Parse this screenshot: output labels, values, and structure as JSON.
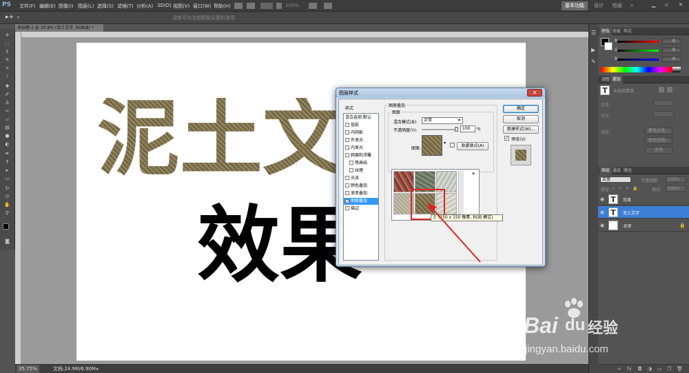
{
  "app": {
    "logo": "PS"
  },
  "menu": [
    "文件(F)",
    "编辑(E)",
    "图像(I)",
    "图层(L)",
    "选择(S)",
    "滤镜(T)",
    "分析(A)",
    "3D(D)",
    "视图(V)",
    "窗口(W)",
    "帮助(H)"
  ],
  "menu_extras": {
    "zoom": "100%"
  },
  "workspace": {
    "essentials": "基本功能",
    "design": "设计",
    "painting": "绘画",
    "more": "»"
  },
  "options_hint": "没有可为当前图层设置的选项",
  "document": {
    "tab_title": "未标题-1 @ 35.8% (泥土文字, RGB/8) *",
    "line1": "泥土文",
    "line2": "效果"
  },
  "statusbar": {
    "zoom": "35.75%",
    "doc_info": "文档:24.9M/6.90M"
  },
  "colors": {
    "accent": "#3d7fd6",
    "texture": "#8a7d57",
    "dialog_bg": "#f0f0f0",
    "arrow": "#e0231f",
    "highlight_box": "#e0231f"
  },
  "panels": {
    "color_tabs": [
      "颜色",
      "色板",
      "样式"
    ],
    "channels": [
      {
        "label": "R",
        "value": "0"
      },
      {
        "label": "G",
        "value": "0"
      },
      {
        "label": "B",
        "value": "0"
      }
    ],
    "char_tabs": [
      "调整",
      "蒙版"
    ],
    "char_hint": "未选择蒙版",
    "char_labels": {
      "density": "浓度:",
      "feather": "羽化:",
      "refine": "调整:"
    },
    "char_buttons": [
      "蒙版边缘...",
      "颜色范围...",
      "反相"
    ],
    "layer_tabs": [
      "图层",
      "通道",
      "路径"
    ],
    "blend_mode": "正常",
    "opacity_label": "不透明度:",
    "opacity_value": "100%",
    "lock_label": "锁定:",
    "fill_label": "填充:",
    "fill_value": "100%",
    "layers": [
      {
        "name": "效果",
        "thumb": "T"
      },
      {
        "name": "泥土文字",
        "thumb": "T"
      },
      {
        "name": "背景",
        "thumb": ""
      }
    ]
  },
  "dialog": {
    "title": "图层样式",
    "styles_header": "样式",
    "styles": [
      {
        "label": "混合选项:默认",
        "checkbox": false
      },
      {
        "label": "投影",
        "checkbox": true
      },
      {
        "label": "内阴影",
        "checkbox": true
      },
      {
        "label": "外发光",
        "checkbox": true
      },
      {
        "label": "内发光",
        "checkbox": true
      },
      {
        "label": "斜面和浮雕",
        "checkbox": true
      },
      {
        "label": "等高线",
        "checkbox": true
      },
      {
        "label": "纹理",
        "checkbox": true
      },
      {
        "label": "光泽",
        "checkbox": true
      },
      {
        "label": "颜色叠加",
        "checkbox": true
      },
      {
        "label": "渐变叠加",
        "checkbox": true
      },
      {
        "label": "图案叠加",
        "checkbox": true,
        "checked": true,
        "selected": true
      },
      {
        "label": "描边",
        "checkbox": true
      }
    ],
    "section_title": "图案叠加",
    "group_title": "图案",
    "blend_label": "混合模式(B):",
    "blend_value": "正常",
    "opacity_label": "不透明度(Y):",
    "opacity_value": "100",
    "opacity_unit": "%",
    "pattern_label": "图案:",
    "snap_button": "贴紧原点(A)",
    "ok": "确定",
    "cancel": "取消",
    "new_style": "新建样式(W)...",
    "preview_label": "预览(V)",
    "tooltip": "土 (150 x 150 像素, RGB 模式)"
  },
  "watermark": {
    "brand": "Bai",
    "brand2": "du",
    "cn": "经验",
    "url": "jingyan.baidu.com"
  }
}
